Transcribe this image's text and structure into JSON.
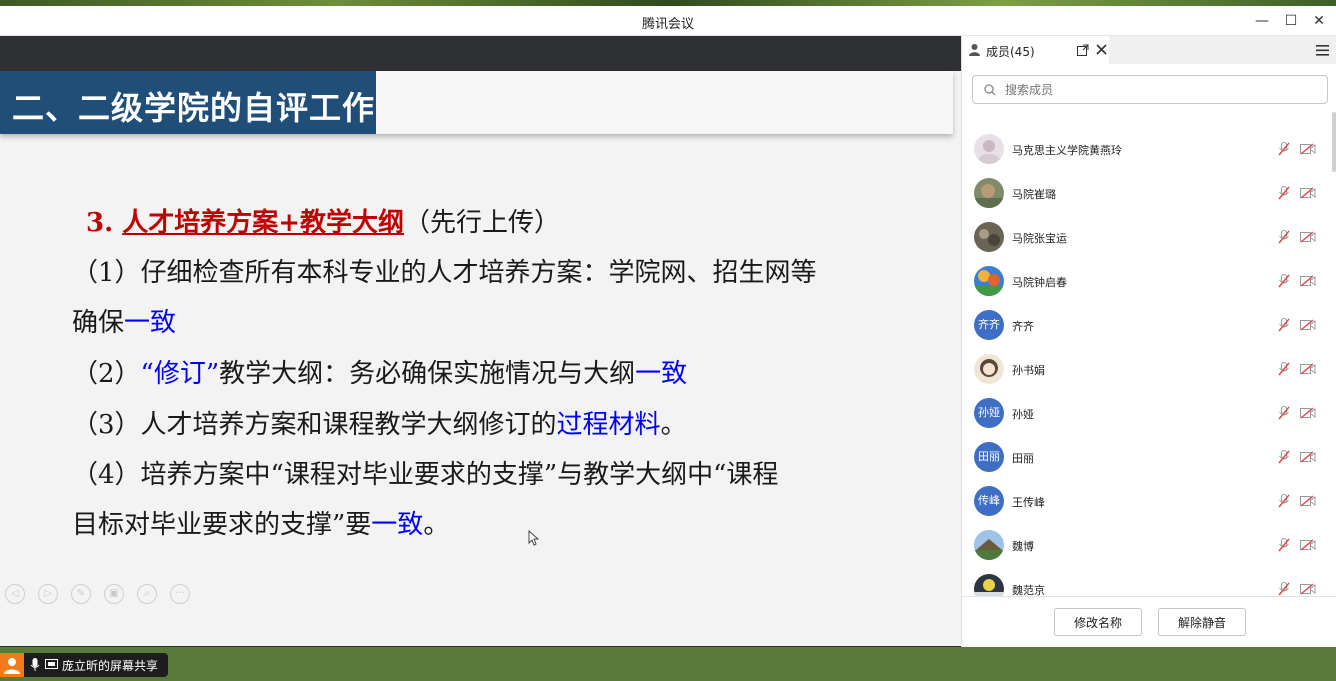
{
  "window": {
    "title": "腾讯会议",
    "minimize": "—",
    "maximize": "☐",
    "close": "✕"
  },
  "slide": {
    "title": "二、二级学院的自评工作",
    "item3_num": "3. ",
    "item3_title": "人才培养方案+教学大纲",
    "item3_suffix": "（先行上传）",
    "l1a": "（1）仔细检查所有本科专业的人才培养方案：学院网、招生网等",
    "l1b": "确保",
    "l1b_blue": "一致",
    "l2a": "（2）",
    "l2_blue": "“修订”",
    "l2b": "教学大纲：务必确保实施情况与大纲",
    "l2_blue2": "一致",
    "l3a": "（3）人才培养方案和课程教学大纲修订的",
    "l3_blue": "过程材料",
    "l3b": "。",
    "l4a": "（4）培养方案中“课程对毕业要求的支撑”与教学大纲中“课程",
    "l4b": "目标对毕业要求的支撑”要",
    "l4_blue": "一致",
    "l4c": "。"
  },
  "share_badge": {
    "text": "庞立昕的屏幕共享"
  },
  "panel": {
    "tab_label": "成员(45)",
    "search_placeholder": "搜索成员",
    "members": [
      {
        "name": "马克思主义学院黄燕玲",
        "avatar": ""
      },
      {
        "name": "马院崔璐",
        "avatar": ""
      },
      {
        "name": "马院张宝运",
        "avatar": ""
      },
      {
        "name": "马院钟启春",
        "avatar": ""
      },
      {
        "name": "齐齐",
        "avatar": "齐齐"
      },
      {
        "name": "孙书娟",
        "avatar": ""
      },
      {
        "name": "孙娅",
        "avatar": "孙娅"
      },
      {
        "name": "田丽",
        "avatar": "田丽"
      },
      {
        "name": "王传峰",
        "avatar": "传峰"
      },
      {
        "name": "魏博",
        "avatar": ""
      },
      {
        "name": "魏范京",
        "avatar": ""
      }
    ],
    "rename_button": "修改名称",
    "unmute_button": "解除静音"
  }
}
